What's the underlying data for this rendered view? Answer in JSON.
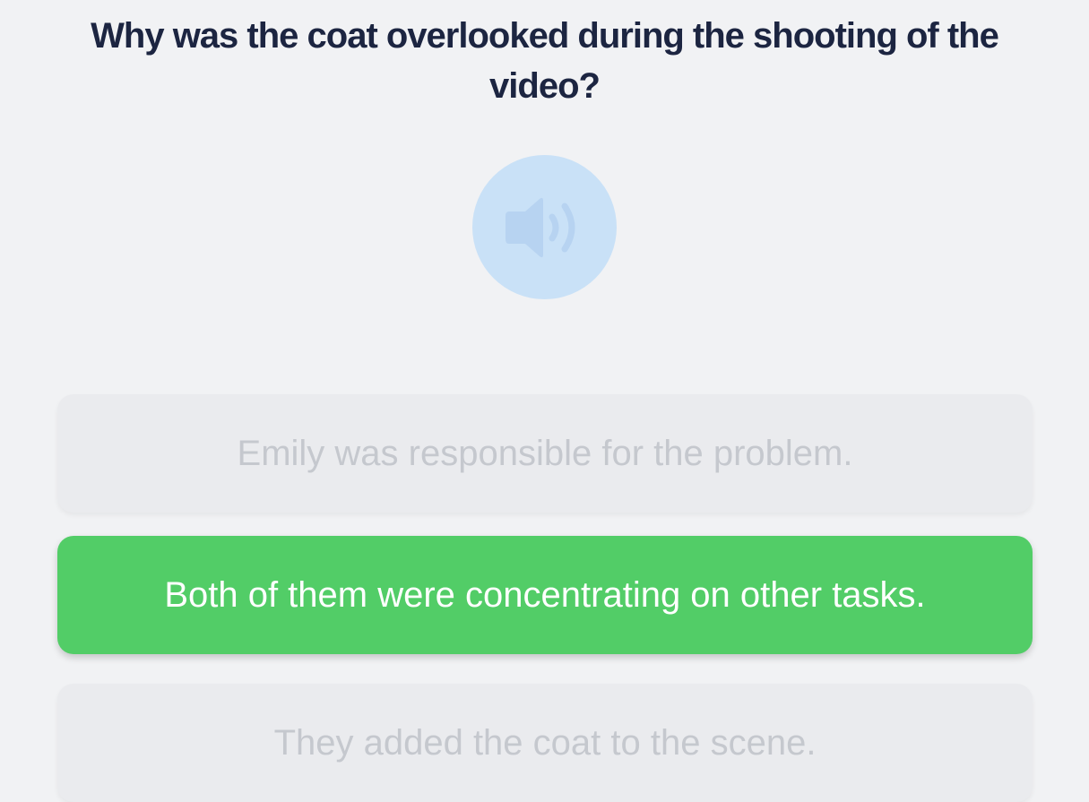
{
  "question": {
    "text": "Why was the coat overlooked during the shooting of the video?"
  },
  "audio": {
    "icon": "speaker-icon",
    "state": "disabled",
    "color": "#c9e1f7"
  },
  "options": [
    {
      "label": "Emily was responsible for the problem.",
      "state": "inactive"
    },
    {
      "label": "Both of them were concentrating on other tasks.",
      "state": "selected"
    },
    {
      "label": "They added the coat to the scene.",
      "state": "inactive"
    }
  ],
  "colors": {
    "background": "#f1f2f4",
    "question_text": "#1c2541",
    "selected": "#52cd67",
    "inactive": "#eaebee",
    "inactive_text": "#c5c8ce"
  }
}
